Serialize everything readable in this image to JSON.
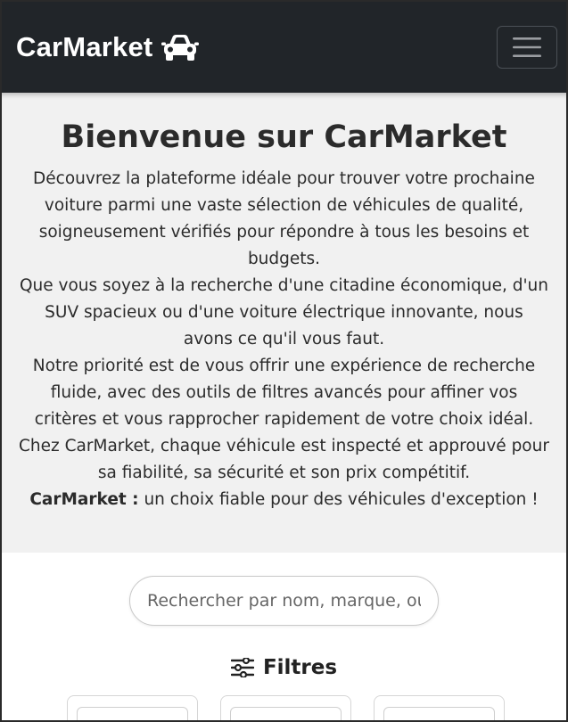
{
  "navbar": {
    "brand": "CarMarket",
    "brand_icon": "car-icon",
    "toggler_icon": "hamburger-menu-icon"
  },
  "hero": {
    "title": "Bienvenue sur CarMarket",
    "paragraph1": "Découvrez la plateforme idéale pour trouver votre prochaine voiture parmi une vaste sélection de véhicules de qualité, soigneusement vérifiés pour répondre à tous les besoins et budgets.",
    "paragraph2": "Que vous soyez à la recherche d'une citadine économique, d'un SUV spacieux ou d'une voiture électrique innovante, nous avons ce qu'il vous faut.",
    "paragraph3": "Notre priorité est de vous offrir une expérience de recherche fluide, avec des outils de filtres avancés pour affiner vos critères et vous rapprocher rapidement de votre choix idéal.",
    "paragraph4": "Chez CarMarket, chaque véhicule est inspecté et approuvé pour sa fiabilité, sa sécurité et son prix compétitif.",
    "tagline_bold": "CarMarket :",
    "tagline_rest": " un choix fiable pour des véhicules d'exception !"
  },
  "search": {
    "placeholder": "Rechercher par nom, marque, ou localisation",
    "value": ""
  },
  "filters": {
    "title": "Filtres",
    "icon": "sliders-icon"
  },
  "colors": {
    "navbar_bg": "#212529",
    "hero_bg": "#f1f1f1",
    "text": "#2b2b2b"
  }
}
